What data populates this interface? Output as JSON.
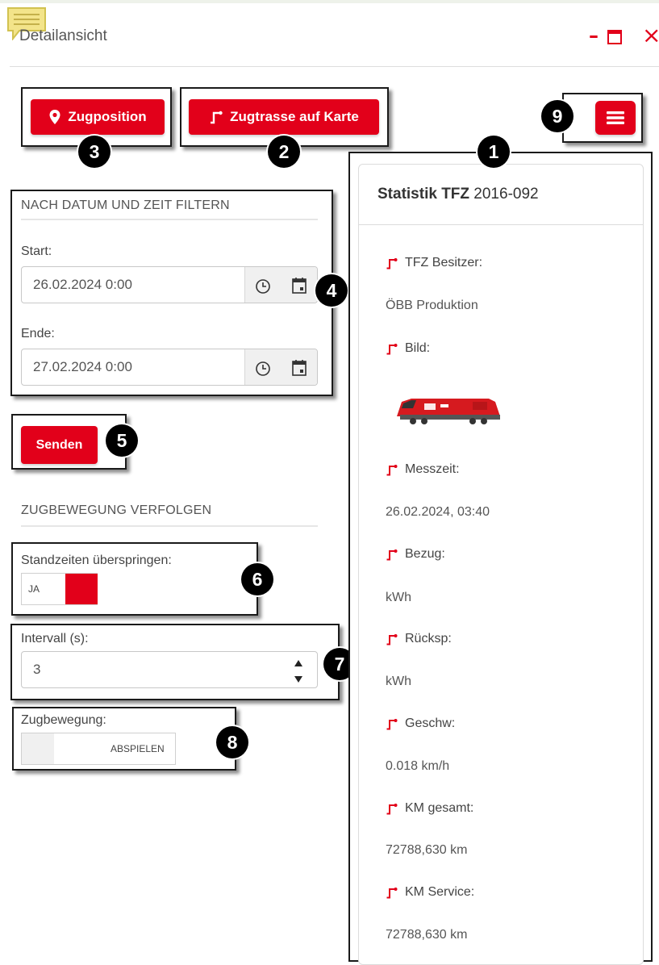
{
  "window": {
    "title": "Detailansicht",
    "controls": {
      "minimize": "–",
      "maximize": "☐",
      "close": "×"
    }
  },
  "colors": {
    "accent": "#e2001a",
    "note_icon": "#f3e48a"
  },
  "buttons": {
    "zugposition": "Zugposition",
    "zugtrasse": "Zugtrasse auf Karte",
    "menu_icon": "hamburger-icon"
  },
  "filter": {
    "title": "NACH DATUM UND ZEIT FILTERN",
    "start_label": "Start:",
    "start_value": "26.02.2024 0:00",
    "end_label": "Ende:",
    "end_value": "27.02.2024 0:00"
  },
  "send_button": "Senden",
  "tracking": {
    "title": "ZUGBEWEGUNG VERFOLGEN",
    "standzeiten_label": "Standzeiten überspringen:",
    "standzeiten_toggle": "JA",
    "intervall_label": "Intervall (s):",
    "intervall_value": "3",
    "zugbewegung_label": "Zugbewegung:",
    "zugbewegung_button": "ABSPIELEN"
  },
  "stats": {
    "title_bold": "Statistik TFZ",
    "title_id": "2016-092",
    "fields": [
      {
        "label": "TFZ Besitzer:",
        "value": "ÖBB Produktion"
      },
      {
        "label": "Bild:",
        "value": ""
      },
      {
        "label": "Messzeit:",
        "value": "26.02.2024, 03:40"
      },
      {
        "label": "Bezug:",
        "value": "kWh"
      },
      {
        "label": "Rücksp:",
        "value": "kWh"
      },
      {
        "label": "Geschw:",
        "value": "0.018 km/h"
      },
      {
        "label": "KM gesamt:",
        "value": "72788,630 km"
      },
      {
        "label": "KM Service:",
        "value": "72788,630 km"
      }
    ]
  },
  "markers": [
    "1",
    "2",
    "3",
    "4",
    "5",
    "6",
    "7",
    "8",
    "9"
  ]
}
